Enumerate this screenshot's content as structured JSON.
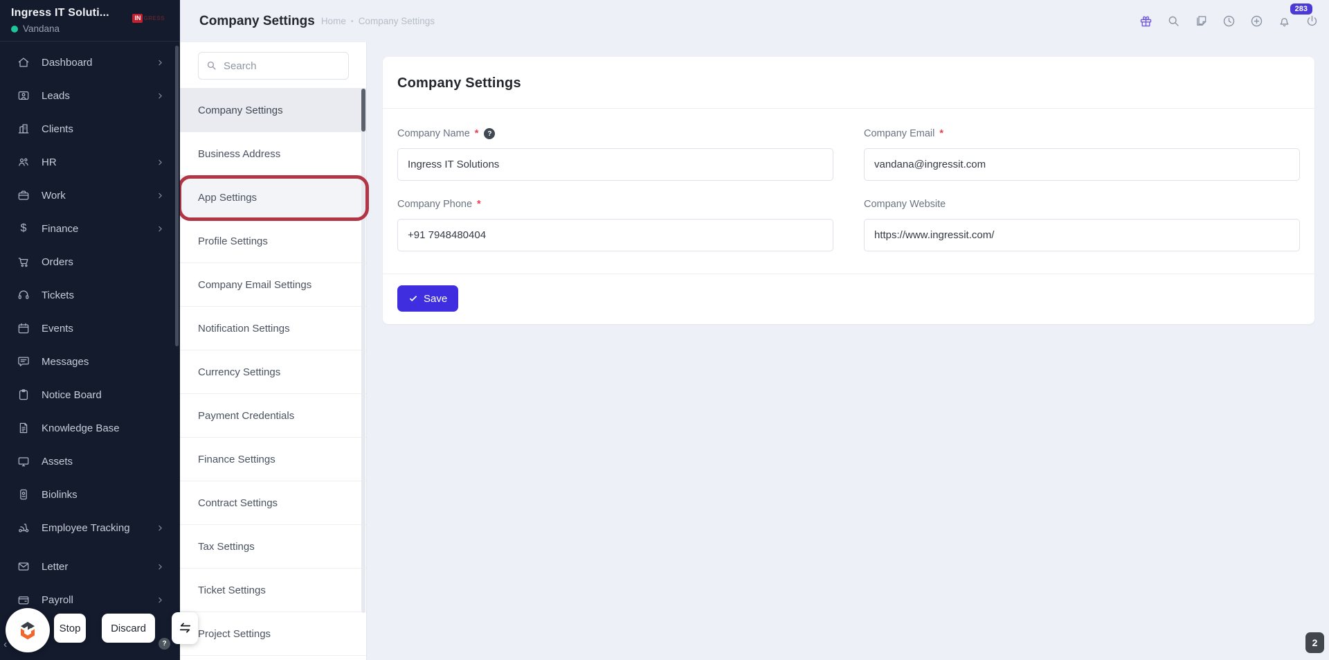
{
  "app": {
    "company_name": "Ingress IT Soluti...",
    "user_name": "Vandana",
    "brand_badge": "IN",
    "brand_badge_suffix": "GRESS"
  },
  "sidebar": {
    "items": [
      {
        "label": "Dashboard",
        "icon": "home-icon",
        "has_submenu": true
      },
      {
        "label": "Leads",
        "icon": "lead-card-icon",
        "has_submenu": true
      },
      {
        "label": "Clients",
        "icon": "buildings-icon",
        "has_submenu": false
      },
      {
        "label": "HR",
        "icon": "people-icon",
        "has_submenu": true
      },
      {
        "label": "Work",
        "icon": "briefcase-icon",
        "has_submenu": true
      },
      {
        "label": "Finance",
        "icon": "dollar-icon",
        "has_submenu": true,
        "glyph": "$"
      },
      {
        "label": "Orders",
        "icon": "cart-icon",
        "has_submenu": false
      },
      {
        "label": "Tickets",
        "icon": "headset-icon",
        "has_submenu": false
      },
      {
        "label": "Events",
        "icon": "calendar-icon",
        "has_submenu": false
      },
      {
        "label": "Messages",
        "icon": "chat-icon",
        "has_submenu": false
      },
      {
        "label": "Notice Board",
        "icon": "clipboard-icon",
        "has_submenu": false
      },
      {
        "label": "Knowledge Base",
        "icon": "document-icon",
        "has_submenu": false
      },
      {
        "label": "Assets",
        "icon": "monitor-icon",
        "has_submenu": false
      },
      {
        "label": "Biolinks",
        "icon": "id-card-icon",
        "has_submenu": false
      },
      {
        "label": "Employee Tracking",
        "icon": "scooter-icon",
        "has_submenu": true
      },
      {
        "label": "Letter",
        "icon": "envelope-icon",
        "has_submenu": true
      },
      {
        "label": "Payroll",
        "icon": "wallet-icon",
        "has_submenu": true
      }
    ]
  },
  "header": {
    "title": "Company Settings",
    "breadcrumb": {
      "home": "Home",
      "separator": "•",
      "current": "Company Settings"
    },
    "notification_count": "283"
  },
  "settings_nav": {
    "search_placeholder": "Search",
    "items": [
      {
        "label": "Company Settings",
        "active": true
      },
      {
        "label": "Business Address"
      },
      {
        "label": "App Settings",
        "annotated": true
      },
      {
        "label": "Profile Settings"
      },
      {
        "label": "Company Email Settings"
      },
      {
        "label": "Notification Settings"
      },
      {
        "label": "Currency Settings"
      },
      {
        "label": "Payment Credentials"
      },
      {
        "label": "Finance Settings"
      },
      {
        "label": "Contract Settings"
      },
      {
        "label": "Tax Settings"
      },
      {
        "label": "Ticket Settings"
      },
      {
        "label": "Project Settings"
      }
    ]
  },
  "main": {
    "card_title": "Company Settings",
    "fields": {
      "company_name": {
        "label": "Company Name",
        "required": "*",
        "value": "Ingress IT Solutions"
      },
      "company_email": {
        "label": "Company Email",
        "required": "*",
        "value": "vandana@ingressit.com"
      },
      "company_phone": {
        "label": "Company Phone",
        "required": "*",
        "value": "+91 7948480404"
      },
      "company_website": {
        "label": "Company Website",
        "value": "https://www.ingressit.com/"
      }
    },
    "save_label": "Save",
    "help_glyph": "?"
  },
  "overlay": {
    "stop_label": "Stop",
    "discard_label": "Discard",
    "help_label": "?",
    "tab_badge": "2"
  },
  "colors": {
    "accent": "#3e2ee0",
    "annotation_red": "#b23546",
    "notification_badge": "#4b3ad6",
    "sidebar_bg": "#141b2d",
    "status_green": "#1fc49a",
    "brand_red": "#c51f2e"
  }
}
